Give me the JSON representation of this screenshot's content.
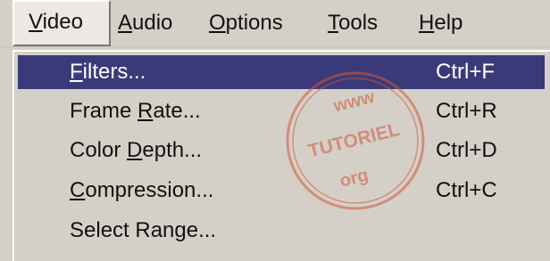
{
  "menubar": {
    "items": [
      {
        "pre": "",
        "accel": "V",
        "post": "ideo"
      },
      {
        "pre": "",
        "accel": "A",
        "post": "udio"
      },
      {
        "pre": "",
        "accel": "O",
        "post": "ptions"
      },
      {
        "pre": "",
        "accel": "T",
        "post": "ools"
      },
      {
        "pre": "",
        "accel": "H",
        "post": "elp"
      }
    ]
  },
  "dropdown": {
    "items": [
      {
        "pre": "",
        "accel": "F",
        "post": "ilters...",
        "shortcut": "Ctrl+F"
      },
      {
        "pre": "Frame ",
        "accel": "R",
        "post": "ate...",
        "shortcut": "Ctrl+R"
      },
      {
        "pre": "Color ",
        "accel": "D",
        "post": "epth...",
        "shortcut": "Ctrl+D"
      },
      {
        "pre": "",
        "accel": "C",
        "post": "ompression...",
        "shortcut": "Ctrl+C"
      },
      {
        "pre": "Select Range...",
        "accel": "",
        "post": "",
        "shortcut": ""
      }
    ]
  },
  "watermark": {
    "top": "www",
    "middle": "TUTORIEL",
    "bottom": "org"
  },
  "colors": {
    "menu_bg": "#d4d0c8",
    "highlight": "#3a3a7a",
    "watermark": "#d2573a"
  }
}
